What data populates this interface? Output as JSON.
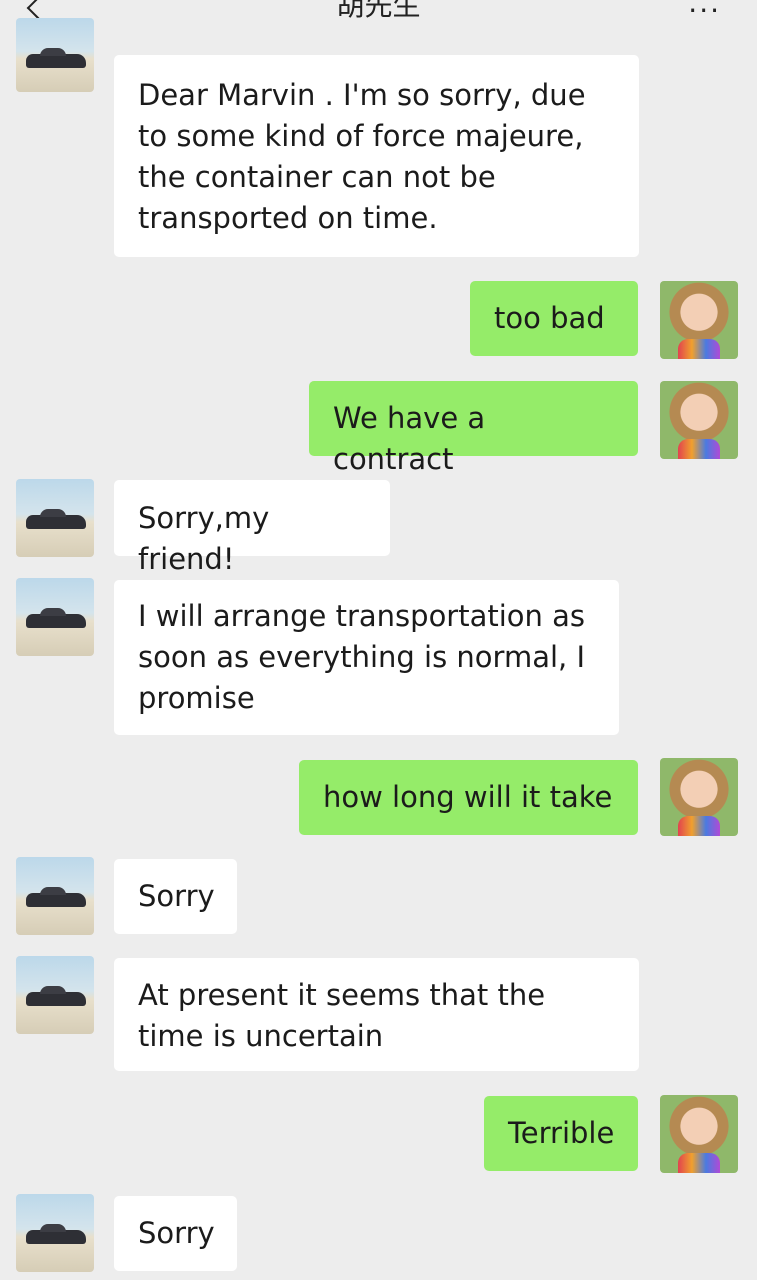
{
  "header": {
    "title": "胡先生",
    "back_icon": "chevron-left-icon",
    "more_label": "···"
  },
  "contact_avatar_icon": "car-avatar",
  "self_avatar_icon": "girl-avatar",
  "colors": {
    "background": "#ededed",
    "incoming_bubble": "#ffffff",
    "outgoing_bubble": "#95ec69"
  },
  "messages": [
    {
      "from": "contact",
      "text": "Dear Marvin . I'm so sorry, due to some kind of force majeure, the container can not be transported on time."
    },
    {
      "from": "me",
      "text": "too bad"
    },
    {
      "from": "me",
      "text": "We have a contract"
    },
    {
      "from": "contact",
      "text": "Sorry,my friend!"
    },
    {
      "from": "contact",
      "text": "I will arrange transportation as soon as everything is normal, I promise"
    },
    {
      "from": "me",
      "text": "how long will it take"
    },
    {
      "from": "contact",
      "text": "Sorry"
    },
    {
      "from": "contact",
      "text": "At present it seems that the time is uncertain"
    },
    {
      "from": "me",
      "text": "Terrible"
    },
    {
      "from": "contact",
      "text": "Sorry"
    }
  ]
}
